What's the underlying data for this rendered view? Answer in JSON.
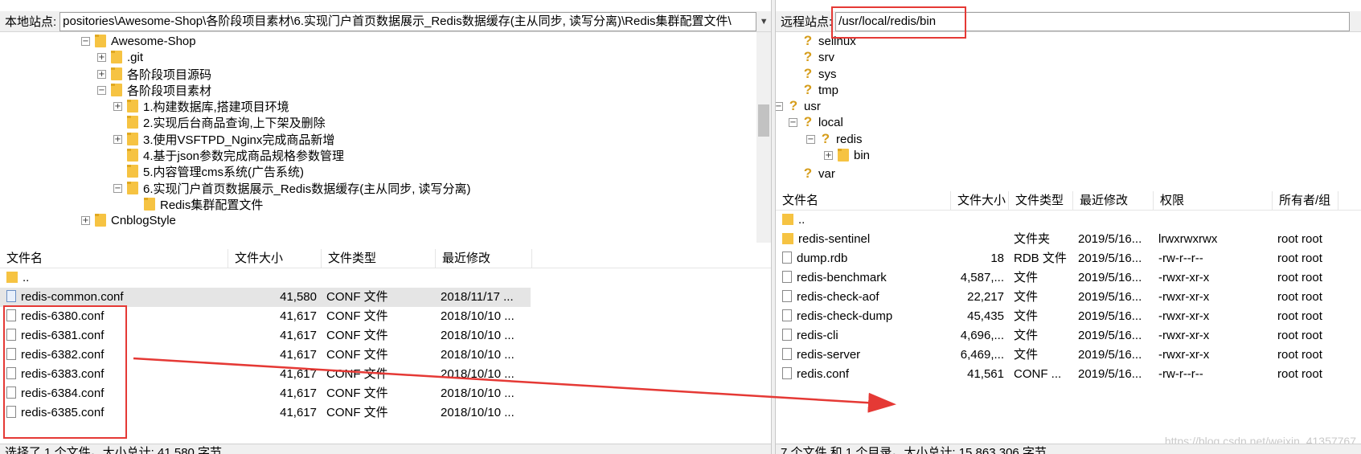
{
  "left": {
    "site_label": "本地站点:",
    "site_path": "positories\\Awesome-Shop\\各阶段项目素材\\6.实现门户首页数据展示_Redis数据缓存(主从同步, 读写分离)\\Redis集群配置文件\\",
    "tree": [
      {
        "label": "Awesome-Shop",
        "expander": "−"
      },
      {
        "label": ".git",
        "expander": "+"
      },
      {
        "label": "各阶段项目源码",
        "expander": "+"
      },
      {
        "label": "各阶段项目素材",
        "expander": "−"
      },
      {
        "label": "1.构建数据库,搭建项目环境",
        "expander": "+"
      },
      {
        "label": "2.实现后台商品查询,上下架及删除",
        "expander": ""
      },
      {
        "label": "3.使用VSFTPD_Nginx完成商品新增",
        "expander": "+"
      },
      {
        "label": "4.基于json参数完成商品规格参数管理",
        "expander": ""
      },
      {
        "label": "5.内容管理cms系统(广告系统)",
        "expander": ""
      },
      {
        "label": "6.实现门户首页数据展示_Redis数据缓存(主从同步, 读写分离)",
        "expander": "−"
      },
      {
        "label": "Redis集群配置文件",
        "expander": ""
      },
      {
        "label": "CnblogStyle",
        "expander": "+"
      }
    ],
    "columns": [
      "文件名",
      "文件大小",
      "文件类型",
      "最近修改"
    ],
    "files": [
      {
        "name": "..",
        "size": "",
        "type": "",
        "modified": ""
      },
      {
        "name": "redis-common.conf",
        "size": "41,580",
        "type": "CONF 文件",
        "modified": "2018/11/17 ..."
      },
      {
        "name": "redis-6380.conf",
        "size": "41,617",
        "type": "CONF 文件",
        "modified": "2018/10/10 ..."
      },
      {
        "name": "redis-6381.conf",
        "size": "41,617",
        "type": "CONF 文件",
        "modified": "2018/10/10 ..."
      },
      {
        "name": "redis-6382.conf",
        "size": "41,617",
        "type": "CONF 文件",
        "modified": "2018/10/10 ..."
      },
      {
        "name": "redis-6383.conf",
        "size": "41,617",
        "type": "CONF 文件",
        "modified": "2018/10/10 ..."
      },
      {
        "name": "redis-6384.conf",
        "size": "41,617",
        "type": "CONF 文件",
        "modified": "2018/10/10 ..."
      },
      {
        "name": "redis-6385.conf",
        "size": "41,617",
        "type": "CONF 文件",
        "modified": "2018/10/10 ..."
      }
    ],
    "status": "选择了 1 个文件。大小总计: 41,580 字节"
  },
  "right": {
    "site_label": "远程站点:",
    "site_path": "/usr/local/redis/bin",
    "tree": [
      {
        "label": "selinux",
        "expander": ""
      },
      {
        "label": "srv",
        "expander": ""
      },
      {
        "label": "sys",
        "expander": ""
      },
      {
        "label": "tmp",
        "expander": ""
      },
      {
        "label": "usr",
        "expander": "−"
      },
      {
        "label": "local",
        "expander": "−"
      },
      {
        "label": "redis",
        "expander": "−"
      },
      {
        "label": "bin",
        "expander": "+"
      },
      {
        "label": "var",
        "expander": ""
      }
    ],
    "columns": [
      "文件名",
      "文件大小",
      "文件类型",
      "最近修改",
      "权限",
      "所有者/组"
    ],
    "files": [
      {
        "name": "..",
        "size": "",
        "type": "",
        "modified": "",
        "perm": "",
        "owner": ""
      },
      {
        "name": "redis-sentinel",
        "size": "",
        "type": "文件夹",
        "modified": "2019/5/16...",
        "perm": "lrwxrwxrwx",
        "owner": "root root"
      },
      {
        "name": "dump.rdb",
        "size": "18",
        "type": "RDB 文件",
        "modified": "2019/5/16...",
        "perm": "-rw-r--r--",
        "owner": "root root"
      },
      {
        "name": "redis-benchmark",
        "size": "4,587,...",
        "type": "文件",
        "modified": "2019/5/16...",
        "perm": "-rwxr-xr-x",
        "owner": "root root"
      },
      {
        "name": "redis-check-aof",
        "size": "22,217",
        "type": "文件",
        "modified": "2019/5/16...",
        "perm": "-rwxr-xr-x",
        "owner": "root root"
      },
      {
        "name": "redis-check-dump",
        "size": "45,435",
        "type": "文件",
        "modified": "2019/5/16...",
        "perm": "-rwxr-xr-x",
        "owner": "root root"
      },
      {
        "name": "redis-cli",
        "size": "4,696,...",
        "type": "文件",
        "modified": "2019/5/16...",
        "perm": "-rwxr-xr-x",
        "owner": "root root"
      },
      {
        "name": "redis-server",
        "size": "6,469,...",
        "type": "文件",
        "modified": "2019/5/16...",
        "perm": "-rwxr-xr-x",
        "owner": "root root"
      },
      {
        "name": "redis.conf",
        "size": "41,561",
        "type": "CONF ...",
        "modified": "2019/5/16...",
        "perm": "-rw-r--r--",
        "owner": "root root"
      }
    ],
    "status": "7 个文件 和 1 个目录。大小总计: 15,863,306 字节"
  },
  "watermark": "https://blog.csdn.net/weixin_41357767",
  "colors": {
    "highlight": "#e53935",
    "folder": "#f6c342",
    "selected_row": "#e5e5e5"
  }
}
